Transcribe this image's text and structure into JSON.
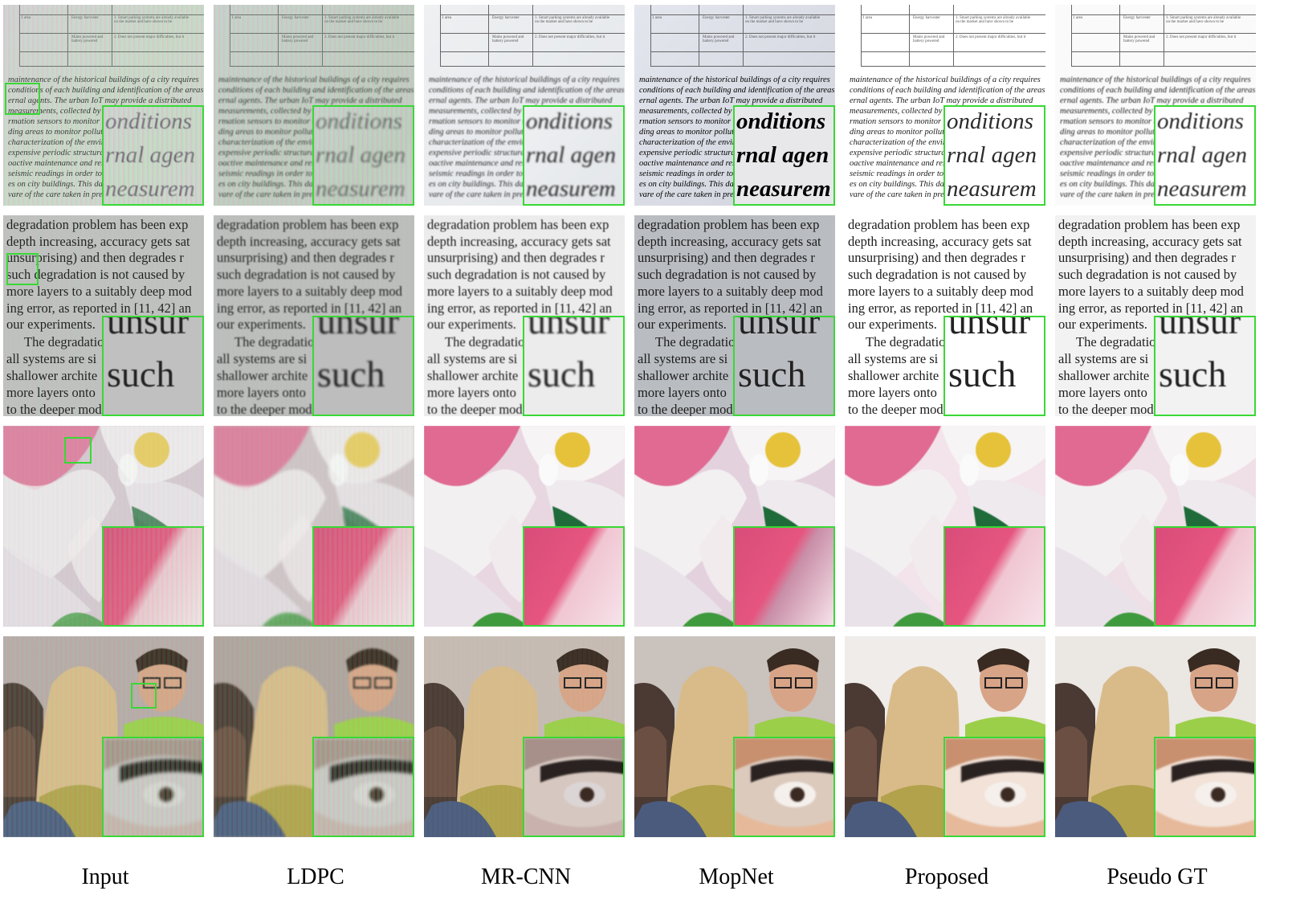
{
  "methods": [
    "Input",
    "LDPC",
    "MR-CNN",
    "MopNet",
    "Proposed",
    "Pseudo GT"
  ],
  "rows": [
    {
      "type": "document",
      "lines": [
        "maintenance of the historical buildings of a city requires",
        "conditions of each building and identification of the areas",
        "ernal agents. The urban IoT may provide a distributed",
        "measurements, collected by s",
        "rmation sensors to monitor th",
        "ding areas to monitor polluti",
        "characterization of the enviro",
        "expensive periodic structural",
        "oactive maintenance and resto",
        "seismic readings in order to b",
        "es on city buildings. This data",
        "vare of the care taken in prese"
      ],
      "zoom_lines": [
        "onditions",
        "rnal agen",
        "neasurem"
      ],
      "table_cells": [
        "1 area",
        "Energy harvester",
        "1. Smart parking systems are already available",
        "on the market and have shown to be",
        "2. Does not present major difficulties, but it",
        "Mains powered and",
        "battery powered"
      ]
    },
    {
      "type": "paper",
      "lines": [
        "degradation problem has been exp",
        "depth increasing, accuracy gets sat",
        "unsurprising) and then degrades r",
        "such degradation is not caused by",
        "more layers to a suitably deep mod",
        "ing error, as reported in [11, 42] an",
        "our experiments.",
        "The degradatio",
        "all systems are si",
        "shallower archite",
        "more layers onto",
        "to the deeper mod"
      ],
      "zoom_lines": [
        "unsur",
        "such"
      ]
    },
    {
      "type": "flower"
    },
    {
      "type": "people"
    }
  ],
  "colors": {
    "zoom_border": "#39d836"
  }
}
